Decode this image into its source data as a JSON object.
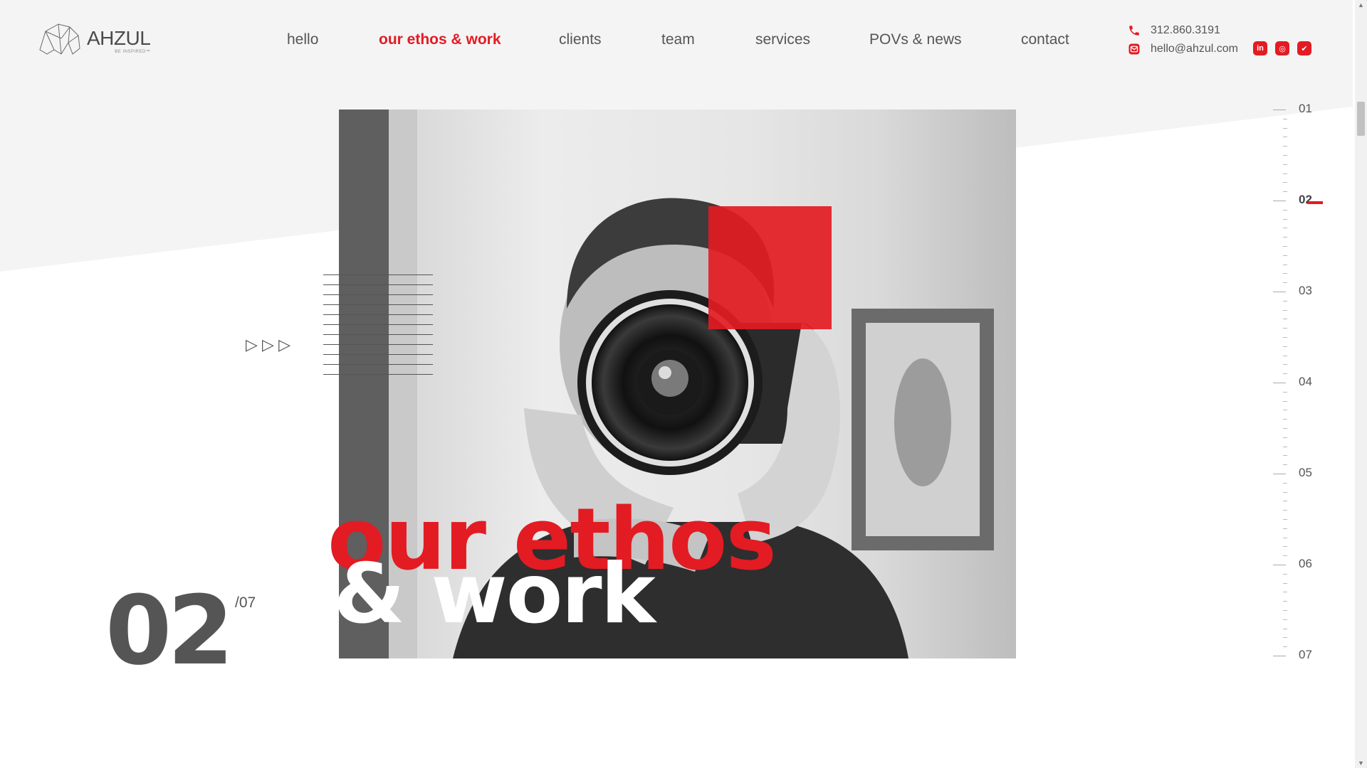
{
  "brand": {
    "name": "AHZUL",
    "tagline": "BE INSPIRED™"
  },
  "nav": {
    "items": [
      {
        "label": "hello",
        "active": false
      },
      {
        "label": "our ethos & work",
        "active": true
      },
      {
        "label": "clients",
        "active": false
      },
      {
        "label": "team",
        "active": false
      },
      {
        "label": "services",
        "active": false
      },
      {
        "label": "POVs & news",
        "active": false
      },
      {
        "label": "contact",
        "active": false
      }
    ]
  },
  "contact": {
    "phone": "312.860.3191",
    "email": "hello@ahzul.com",
    "phone_icon": "phone-icon",
    "email_icon": "email-icon"
  },
  "social": [
    {
      "icon": "linkedin-icon",
      "glyph": "in"
    },
    {
      "icon": "instagram-icon",
      "glyph": "◎"
    },
    {
      "icon": "twitter-icon",
      "glyph": "✔"
    }
  ],
  "hero": {
    "headline_line1": "our ethos",
    "headline_line2": "& work",
    "arrows": "▷ ▷ ▷"
  },
  "counter": {
    "current": "02",
    "total": "/07"
  },
  "sections": [
    "01",
    "02",
    "03",
    "04",
    "05",
    "06",
    "07"
  ],
  "active_section": "02",
  "colors": {
    "accent": "#e31b23",
    "text": "#555555",
    "bg_grey": "#f4f4f4"
  }
}
